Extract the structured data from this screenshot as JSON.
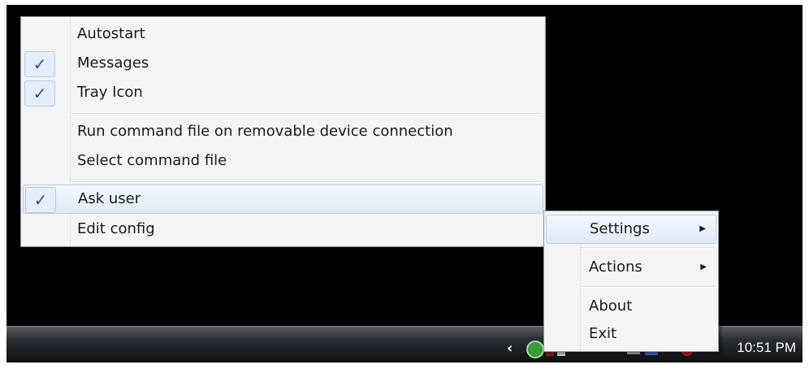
{
  "settings_menu": {
    "items": [
      {
        "label": "Autostart",
        "checked": false
      },
      {
        "label": "Messages",
        "checked": true
      },
      {
        "label": "Tray Icon",
        "checked": true
      },
      {
        "label": "Run command file on removable device connection",
        "checked": false
      },
      {
        "label": "Select command file",
        "checked": false
      },
      {
        "label": "Ask user",
        "checked": true
      },
      {
        "label": "Edit config",
        "checked": false
      }
    ],
    "check_glyph": "✓"
  },
  "tray_menu": {
    "settings_label": "Settings",
    "actions_label": "Actions",
    "about_label": "About",
    "exit_label": "Exit",
    "arrow_glyph": "▶"
  },
  "taskbar": {
    "chevron": "‹",
    "clock": "10:51 PM"
  },
  "colors": {
    "check": "#1f50b8",
    "highlight": "#dfe9f8"
  }
}
